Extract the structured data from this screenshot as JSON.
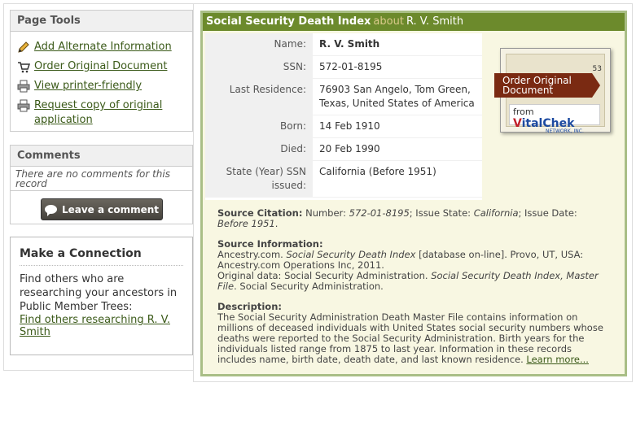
{
  "page_tools": {
    "title": "Page Tools",
    "items": [
      {
        "label": "Add Alternate Information",
        "icon": "pencil-icon"
      },
      {
        "label": "Order Original Document",
        "icon": "cart-icon"
      },
      {
        "label": "View printer-friendly",
        "icon": "printer-icon"
      },
      {
        "label": "Request copy of original application",
        "icon": "printer-icon"
      }
    ]
  },
  "comments": {
    "title": "Comments",
    "empty_text": "There are no comments for this record",
    "button_label": "Leave a comment"
  },
  "connection": {
    "title": "Make a Connection",
    "text": "Find others who are researching your ancestors in Public Member Trees:",
    "link": "Find others researching R. V. Smith"
  },
  "record": {
    "collection": "Social Security Death Index",
    "about": "about",
    "person": "R. V. Smith",
    "fields": [
      {
        "label": "Name:",
        "value": "R. V. Smith"
      },
      {
        "label": "SSN:",
        "value": "572-01-8195"
      },
      {
        "label": "Last Residence:",
        "value": "76903  San Angelo, Tom Green, Texas, United States of America"
      },
      {
        "label": "Born:",
        "value": "14 Feb 1910"
      },
      {
        "label": "Died:",
        "value": "20 Feb 1990"
      },
      {
        "label": "State (Year) SSN issued:",
        "value": "California (Before 1951)"
      }
    ]
  },
  "order_card": {
    "ribbon": "Order Original Document",
    "from": "from",
    "brand_v": "V",
    "brand_rest": "italChek",
    "brand_sub": "NETWORK, INC.",
    "number": "53"
  },
  "source": {
    "citation_label": "Source Citation:",
    "citation_number_prefix": "Number: ",
    "citation_number": "572-01-8195",
    "citation_state_prefix": "; Issue State: ",
    "citation_state": "California",
    "citation_date_prefix": "; Issue Date: ",
    "citation_date": "Before 1951",
    "citation_end": ".",
    "info_label": "Source Information:",
    "info_line1_a": "Ancestry.com. ",
    "info_line1_b": "Social Security Death Index",
    "info_line1_c": " [database on-line]. Provo, UT, USA: Ancestry.com Operations Inc, 2011.",
    "info_line2_a": "Original data: Social Security Administration. ",
    "info_line2_b": "Social Security Death Index, Master File",
    "info_line2_c": ". Social Security Administration.",
    "desc_label": "Description:",
    "description": "The Social Security Administration Death Master File contains information on millions of deceased individuals with United States social security numbers whose deaths were reported to the Social Security Administration. Birth years for the individuals listed range from 1875 to last year. Information in these records includes name, birth date, death date, and last known residence. ",
    "learn_more": "Learn more..."
  }
}
